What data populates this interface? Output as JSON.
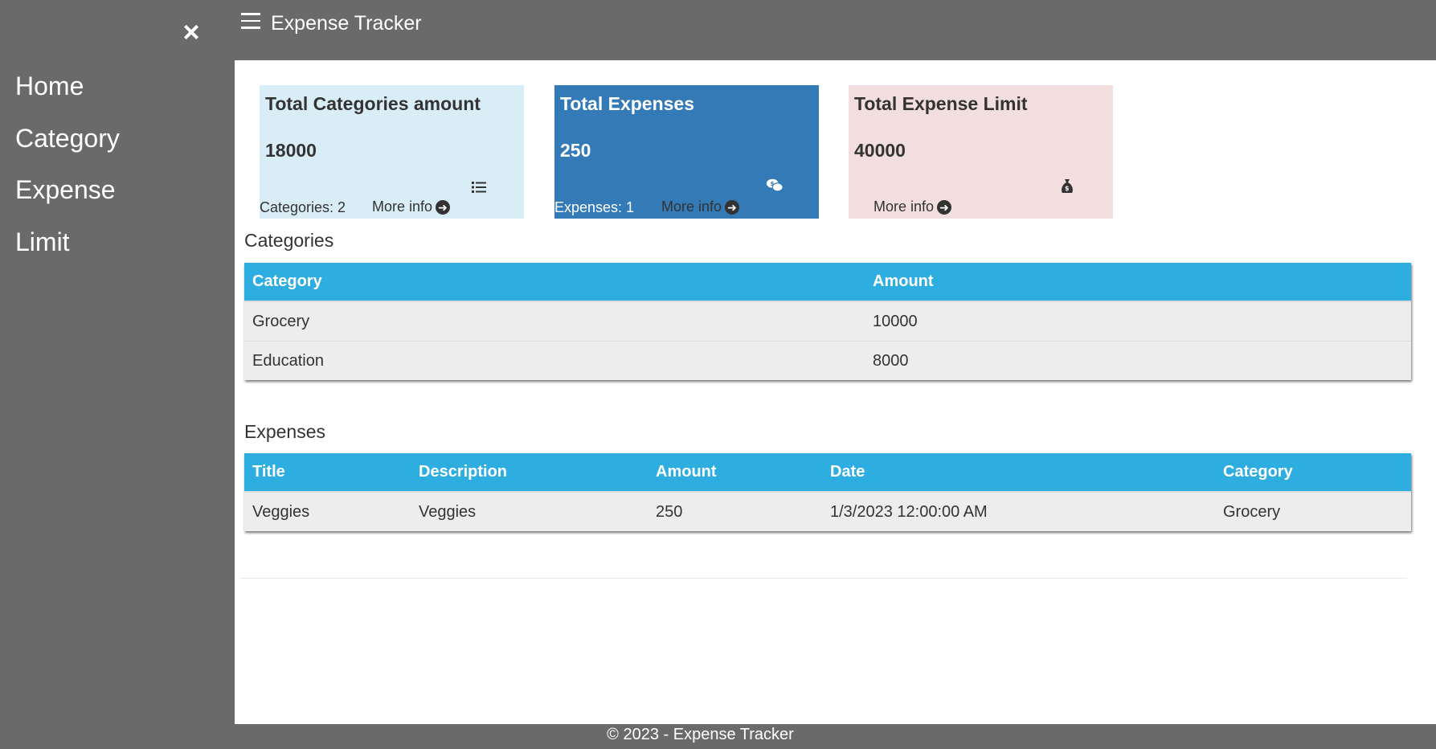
{
  "app": {
    "title": "Expense Tracker"
  },
  "sidebar": {
    "close_glyph": "×",
    "items": [
      {
        "label": "Home"
      },
      {
        "label": "Category"
      },
      {
        "label": "Expense"
      },
      {
        "label": "Limit"
      }
    ]
  },
  "cards": [
    {
      "title": "Total Categories amount",
      "value": "18000",
      "count_text": "Categories: 2",
      "more": "More info",
      "icon": "list-icon",
      "bg": "#d9edf7",
      "fg": "#333333"
    },
    {
      "title": "Total Expenses",
      "value": "250",
      "count_text": "Expenses: 1",
      "more": "More info",
      "icon": "money-chat-icon",
      "bg": "#337ab7",
      "fg": "#ffffff"
    },
    {
      "title": "Total Expense Limit",
      "value": "40000",
      "count_text": "",
      "more": "More info",
      "icon": "money-bag-icon",
      "bg": "#f2dede",
      "fg": "#333333"
    }
  ],
  "categories": {
    "heading": "Categories",
    "headers": [
      "Category",
      "Amount"
    ],
    "rows": [
      [
        "Grocery",
        "10000"
      ],
      [
        "Education",
        "8000"
      ]
    ]
  },
  "expenses": {
    "heading": "Expenses",
    "headers": [
      "Title",
      "Description",
      "Amount",
      "Date",
      "Category"
    ],
    "rows": [
      [
        "Veggies",
        "Veggies",
        "250",
        "1/3/2023 12:00:00 AM",
        "Grocery"
      ]
    ]
  },
  "footer": {
    "text": "© 2023 - Expense Tracker"
  },
  "colors": {
    "sidebar": "#6b6a6a",
    "table_header": "#2eaee0",
    "table_row": "#eeeded"
  }
}
